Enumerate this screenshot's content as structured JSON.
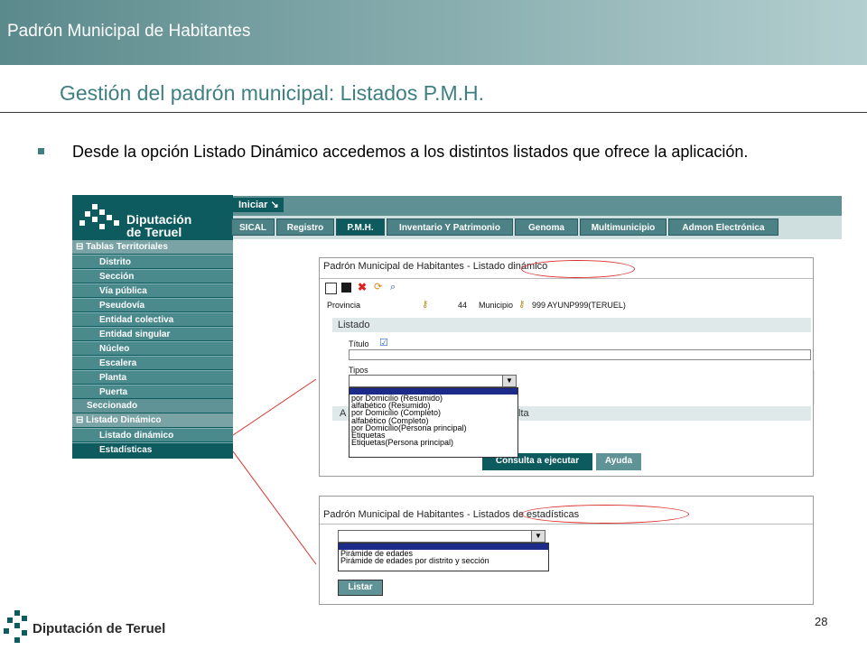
{
  "header": {
    "title": "Padrón Municipal de Habitantes"
  },
  "slide": {
    "title": "Gestión del padrón municipal: Listados P.M.H.",
    "bullet": "Desde la opción Listado Dinámico accedemos a los distintos listados que ofrece la aplicación."
  },
  "app": {
    "logo_line1": "Diputación",
    "logo_line2": "de Teruel",
    "iniciar_label": "Iniciar ↘",
    "tabs": [
      "SICAL",
      "Registro",
      "P.M.H.",
      "Inventario Y Patrimonio",
      "Genoma",
      "Multimunicipio",
      "Admon Electrónica"
    ],
    "active_tab": "P.M.H.",
    "sidebar": {
      "group1": "⊟ Tablas Territoriales",
      "items1": [
        "Distrito",
        "Sección",
        "Vía pública",
        "Pseudovía",
        "Entidad colectiva",
        "Entidad singular",
        "Núcleo",
        "Escalera",
        "Planta",
        "Puerta"
      ],
      "seccionado": "Seccionado",
      "group2": "⊟ Listado Dinámico",
      "items2": [
        "Listado dinámico",
        "Estadísticas"
      ]
    }
  },
  "dialog_dynamic": {
    "title_prefix": "Padrón Municipal de Habitantes - ",
    "title_highlight": "Listado dinámico",
    "provincia_label": "Provincia",
    "provincia_value": "44",
    "municipio_label": "Municipio",
    "municipio_value": "999 AYUNP999(TERUEL)",
    "section_listado": "Listado",
    "titulo_label": "Título",
    "tipos_label": "Tipos",
    "section_a": "A",
    "section_lta": "lta",
    "tipos_options": [
      "por Domicilio (Resumido)",
      "alfabético (Resumido)",
      "por Domicilio (Completo)",
      "alfabético (Completo)",
      "por Domicilio(Persona principal)",
      "Etiquetas",
      "Etiquetas(Persona principal)"
    ],
    "consulta_button": "Consulta a ejecutar",
    "ayuda_button": "Ayuda"
  },
  "dialog_stats": {
    "title_prefix": "Padrón Municipal de Habitantes - ",
    "title_highlight": "Listados de estadísticas",
    "options": [
      "Pirámide de edades",
      "Pirámide de edades por distrito y sección"
    ],
    "listar_button": "Listar"
  },
  "footer": {
    "logo_text": "Diputación de Teruel",
    "page_number": "28"
  },
  "colors": {
    "teal_dark": "#0d5b5f",
    "teal_title": "#3f7f81",
    "highlight_red": "#d9302c"
  }
}
